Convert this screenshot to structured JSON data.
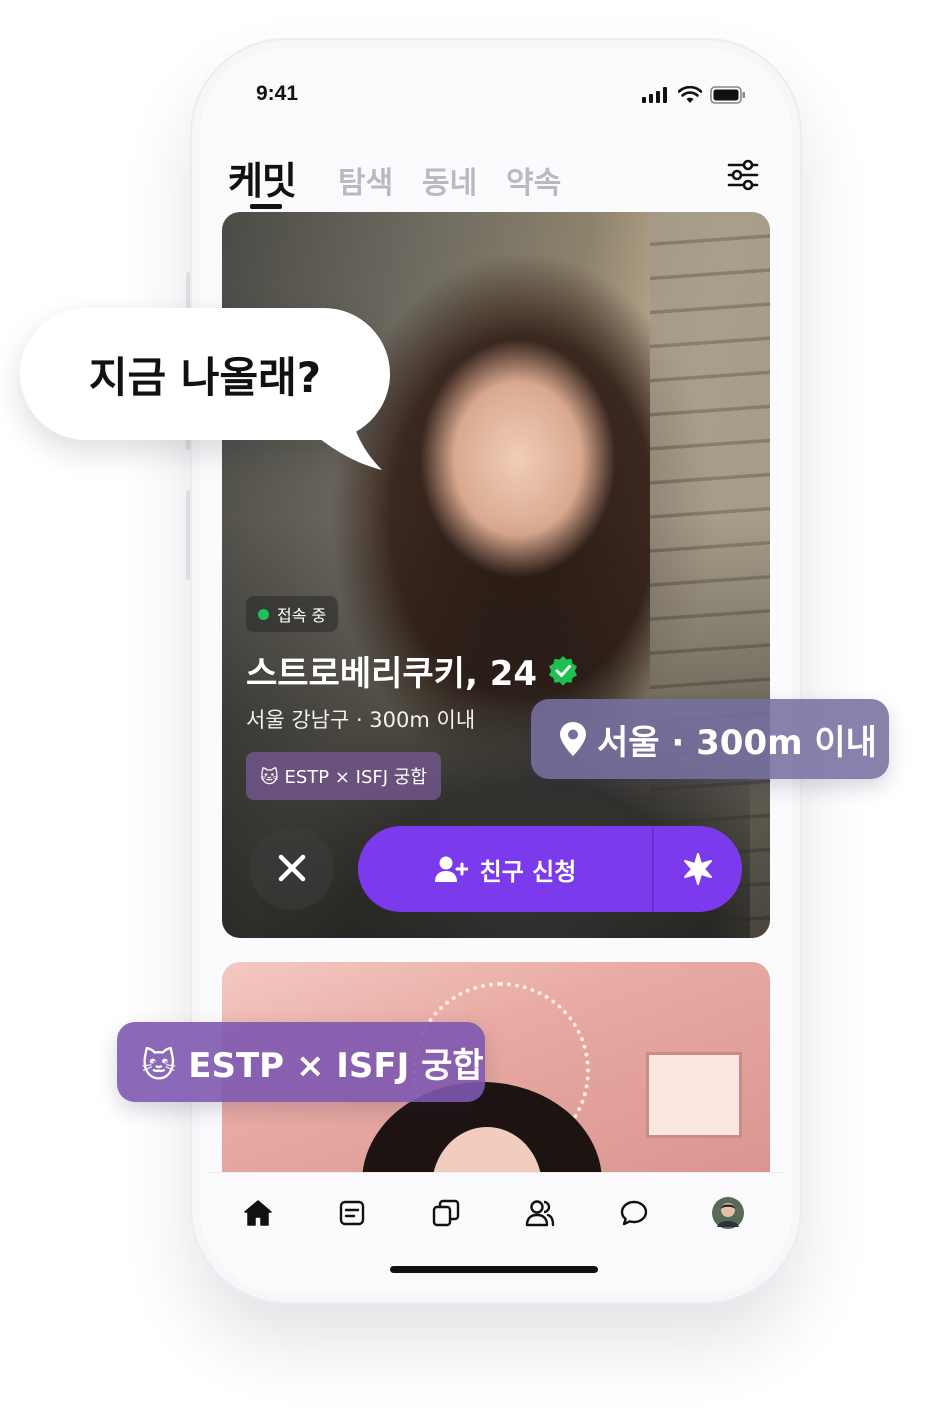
{
  "status_bar": {
    "time": "9:41"
  },
  "top_nav": {
    "brand": "케밋",
    "tabs": [
      "탐색",
      "동네",
      "약속"
    ]
  },
  "profile_card": {
    "online_status": "접속 중",
    "name_age": "스트로베리쿠키, 24",
    "location": "서울 강남구 · 300m 이내",
    "mbti_chip": "🐱 ESTP × ISFJ 궁합",
    "friend_request_label": "친구 신청"
  },
  "overlays": {
    "speech_bubble": "지금 나올래?",
    "location_pill": "서울 · 300m 이내",
    "mbti_pill": "🐱 ESTP × ISFJ 궁합"
  },
  "tab_bar": {
    "items": [
      "home-icon",
      "feed-icon",
      "cards-icon",
      "friends-icon",
      "chat-icon",
      "profile-avatar"
    ]
  },
  "colors": {
    "accent": "#7c3aed",
    "online": "#1fc15a",
    "verified": "#1fbf4f"
  }
}
